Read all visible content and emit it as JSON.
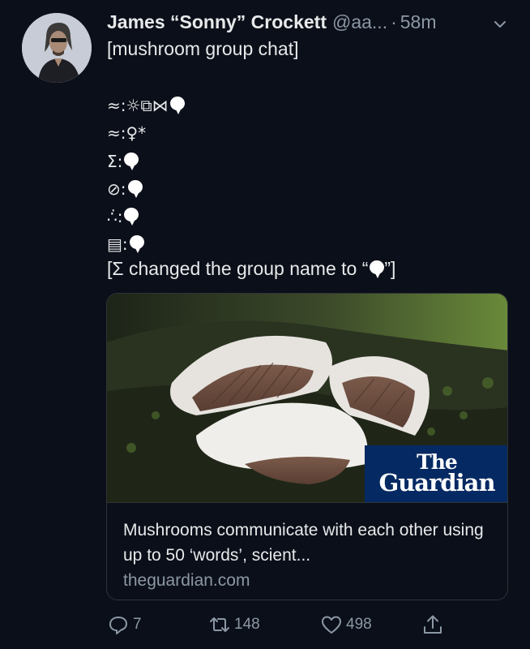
{
  "tweet": {
    "display_name": "James “Sonny” Crockett",
    "handle": "@aa...",
    "separator": "·",
    "time": "58m",
    "text_line1": "[mushroom group chat]",
    "chat": [
      {
        "sender": "≈:",
        "content": " ☼⧉⋈"
      },
      {
        "sender": "≈:",
        "content": " ♀*"
      },
      {
        "sender": "Σ:",
        "content": ""
      },
      {
        "sender": "⊘:",
        "content": ""
      },
      {
        "sender": "∴̇:",
        "content": ""
      },
      {
        "sender": "▤:",
        "content": ""
      }
    ],
    "name_change": {
      "prefix": "[Σ changed the group name to “",
      "suffix": "”]"
    }
  },
  "card": {
    "logo_line1": "The",
    "logo_line2": "Guardian",
    "title": "Mushrooms communicate with each other using up to 50 ‘words’, scient...",
    "domain": "theguardian.com"
  },
  "actions": {
    "reply_count": "7",
    "retweet_count": "148",
    "like_count": "498",
    "reply_icon": "reply-icon",
    "retweet_icon": "retweet-icon",
    "like_icon": "heart-icon",
    "share_icon": "share-icon"
  },
  "colors": {
    "background": "#0b0f19",
    "text": "#e7e9ea",
    "muted": "#8b98a5",
    "guardian_blue": "#052962"
  }
}
